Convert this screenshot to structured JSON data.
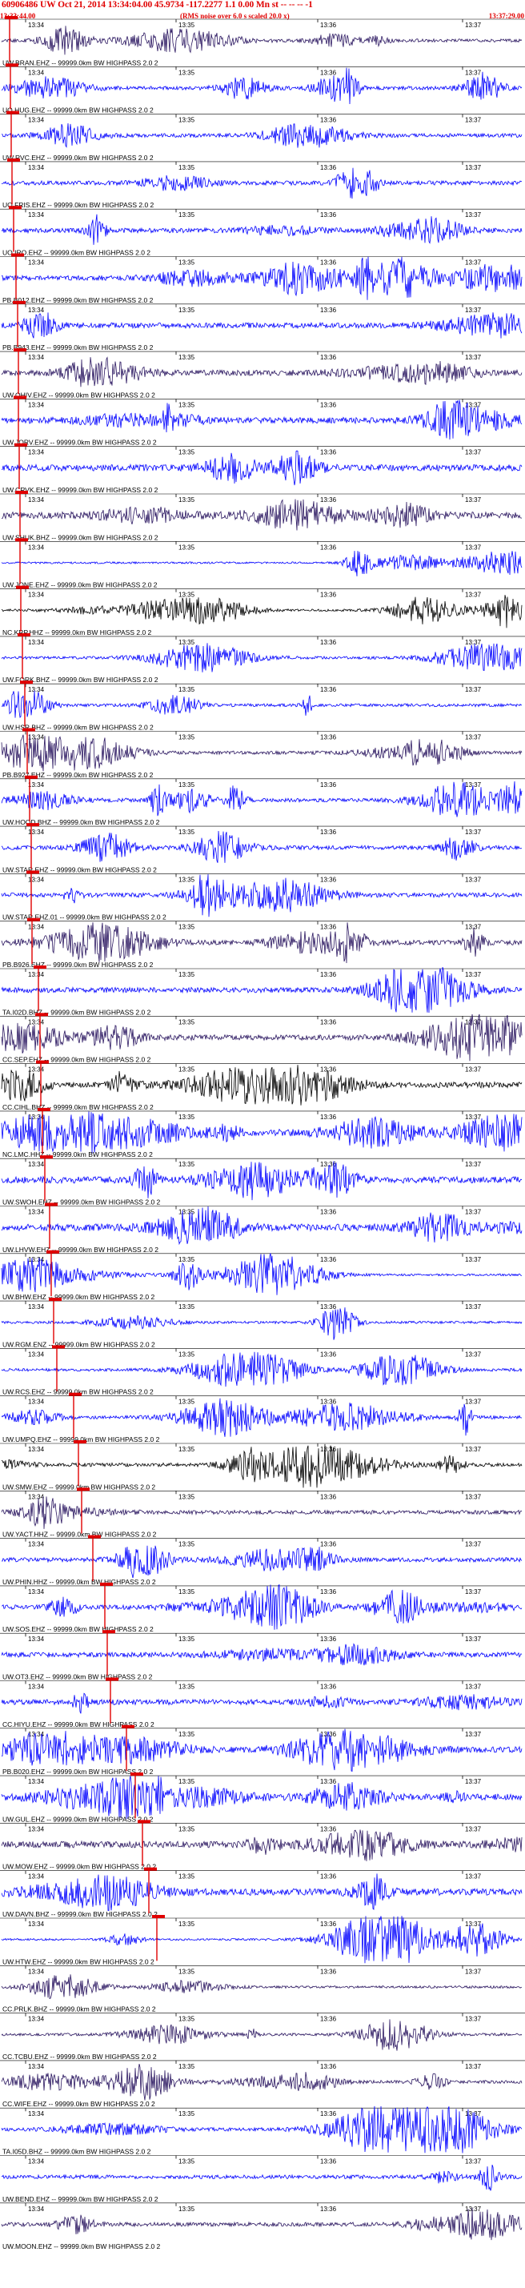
{
  "header": {
    "title": "60906486 UW Oct 21, 2014 13:34:04.00   45.9734 -117.2277  1.1 0.00 Mn st -- -- -- -1",
    "start_time": "13:33:44.00",
    "note": "(RMS noise over 6.0 s scaled 20.0 x)",
    "end_time": "13:37:29.00"
  },
  "colors": {
    "header_red": "#e00000",
    "trace_blue": "#0000ff",
    "trace_purple": "#2a1660",
    "trace_black": "#000000",
    "pick_red": "#e00000",
    "gridline": "#000000"
  },
  "chart_data": {
    "type": "line",
    "title": "60906486 UW Oct 21, 2014 13:34:04.00   45.9734 -117.2277  1.1 0.00 Mn st -- -- -- -1",
    "xlabel": "",
    "ylabel": "",
    "xlim": [
      "13:33:44.00",
      "13:37:29.00"
    ],
    "time_ticks": [
      "13:34",
      "13:35",
      "13:36",
      "13:37"
    ],
    "grid": true,
    "series": [
      {
        "name": "UW.BRAN.EHZ -- 99999.0km BW HIGHPASS 2.0 2",
        "color": "purple",
        "pick": 12
      },
      {
        "name": "UO.HUG.EHZ -- 99999.0km BW HIGHPASS 2.0 2",
        "color": "blue",
        "pick": 13
      },
      {
        "name": "UW.RVC.EHZ -- 99999.0km BW HIGHPASS 2.0 2",
        "color": "blue",
        "pick": 14
      },
      {
        "name": "UO.FRIS.EHZ -- 99999.0km BW HIGHPASS 2.0 2",
        "color": "blue",
        "pick": 15
      },
      {
        "name": "UO.IRO.EHZ -- 99999.0km BW HIGHPASS 2.0 2",
        "color": "blue",
        "pick": 17
      },
      {
        "name": "PB.B012.EHZ -- 99999.0km BW HIGHPASS 2.0 2",
        "color": "blue",
        "pick": 20
      },
      {
        "name": "PB.B943.EHZ -- 99999.0km BW HIGHPASS 2.0 2",
        "color": "blue",
        "pick": 22
      },
      {
        "name": "UW.OHIV.EHZ -- 99999.0km BW HIGHPASS 2.0 2",
        "color": "purple",
        "pick": 23
      },
      {
        "name": "UW.JORV.EHZ -- 99999.0km BW HIGHPASS 2.0 2",
        "color": "blue",
        "pick": 23
      },
      {
        "name": "UW.CRVK.EHZ -- 99999.0km BW HIGHPASS 2.0 2",
        "color": "blue",
        "pick": 24
      },
      {
        "name": "UW.SHUK.BHZ -- 99999.0km BW HIGHPASS 2.0 2",
        "color": "purple",
        "pick": 25
      },
      {
        "name": "UW.JONE.EHZ -- 99999.0km BW HIGHPASS 2.0 2",
        "color": "blue",
        "pick": 25
      },
      {
        "name": "NC.KRP.HHZ -- 99999.0km BW HIGHPASS 2.0 2",
        "color": "black",
        "pick": 26
      },
      {
        "name": "UW.FORK.BHZ -- 99999.0km BW HIGHPASS 2.0 2",
        "color": "blue",
        "pick": 28
      },
      {
        "name": "UW.HSR.BHZ -- 99999.0km BW HIGHPASS 2.0 2",
        "color": "blue",
        "pick": 31
      },
      {
        "name": "PB.B927.EHZ -- 99999.0km BW HIGHPASS 2.0 2",
        "color": "purple",
        "pick": 34
      },
      {
        "name": "UW.HOOD.BHZ -- 99999.0km BW HIGHPASS 2.0 2",
        "color": "blue",
        "pick": 37
      },
      {
        "name": "UW.STAR.EHZ -- 99999.0km BW HIGHPASS 2.0 2",
        "color": "blue",
        "pick": 39
      },
      {
        "name": "UW.STAR.EHZ.01 -- 99999.0km BW HIGHPASS 2.0 2",
        "color": "blue",
        "pick": 39
      },
      {
        "name": "PB.B926.EHZ -- 99999.0km BW HIGHPASS 2.0 2",
        "color": "purple",
        "pick": 40
      },
      {
        "name": "TA.I02D.BHZ -- 99999.0km BW HIGHPASS 2.0 2",
        "color": "blue",
        "pick": 48
      },
      {
        "name": "CC.SEP.EHZ -- 99999.0km BW HIGHPASS 2.0 2",
        "color": "purple",
        "pick": 50
      },
      {
        "name": "CC.CIHL.BHZ -- 99999.0km BW HIGHPASS 2.0 2",
        "color": "black",
        "pick": 51
      },
      {
        "name": "NC.LMC.HHZ -- 99999.0km BW HIGHPASS 2.0 2",
        "color": "blue",
        "pick": 53
      },
      {
        "name": "UW.SWOH.EHZ -- 99999.0km BW HIGHPASS 2.0 2",
        "color": "blue",
        "pick": 56
      },
      {
        "name": "UW.LHVW.EHZ -- 99999.0km BW HIGHPASS 2.0 2",
        "color": "blue",
        "pick": 62
      },
      {
        "name": "UW.BHW.EHZ -- 99999.0km BW HIGHPASS 2.0 2",
        "color": "blue",
        "pick": 64
      },
      {
        "name": "UW.RGM.ENZ -- 99999.0km BW HIGHPASS 2.0 2",
        "color": "blue",
        "pick": 67
      },
      {
        "name": "UW.RCS.EHZ -- 99999.0km BW HIGHPASS 2.0 2",
        "color": "blue",
        "pick": 71
      },
      {
        "name": "UW.UMPQ.EHZ -- 99999.0km BW HIGHPASS 2.0 2",
        "color": "blue",
        "pick": 92
      },
      {
        "name": "UW.SMW.EHZ -- 99999.0km BW HIGHPASS 2.0 2",
        "color": "black",
        "pick": 98
      },
      {
        "name": "UW.YACT.HHZ -- 99999.0km BW HIGHPASS 2.0 2",
        "color": "purple",
        "pick": 102
      },
      {
        "name": "UW.PHIN.HHZ -- 99999.0km BW HIGHPASS 2.0 2",
        "color": "blue",
        "pick": 116
      },
      {
        "name": "UW.SOS.EHZ -- 99999.0km BW HIGHPASS 2.0 2",
        "color": "blue",
        "pick": 131
      },
      {
        "name": "UW.OT3.EHZ -- 99999.0km BW HIGHPASS 2.0 2",
        "color": "blue",
        "pick": 134
      },
      {
        "name": "CC.HIYU.EHZ -- 99999.0km BW HIGHPASS 2.0 2",
        "color": "blue",
        "pick": 138
      },
      {
        "name": "PB.B020.EHZ -- 99999.0km BW HIGHPASS 2.0 2",
        "color": "blue",
        "pick": 158
      },
      {
        "name": "UW.GUL.EHZ -- 99999.0km BW HIGHPASS 2.0 2",
        "color": "blue",
        "pick": 169
      },
      {
        "name": "UW.MOW.EHZ -- 99999.0km BW HIGHPASS 2.0 2",
        "color": "purple",
        "pick": 178
      },
      {
        "name": "UW.DAVN.BHZ -- 99999.0km BW HIGHPASS 2.0 2",
        "color": "blue",
        "pick": 186
      },
      {
        "name": "UW.HTW.EHZ -- 99999.0km BW HIGHPASS 2.0 2",
        "color": "blue",
        "pick": 196
      },
      {
        "name": "CC.PRLK.BHZ -- 99999.0km BW HIGHPASS 2.0 2",
        "color": "purple",
        "pick": null
      },
      {
        "name": "CC.TCBU.EHZ -- 99999.0km BW HIGHPASS 2.0 2",
        "color": "purple",
        "pick": null
      },
      {
        "name": "CC.WIFE.EHZ -- 99999.0km BW HIGHPASS 2.0 2",
        "color": "purple",
        "pick": null
      },
      {
        "name": "TA.I05D.BHZ -- 99999.0km BW HIGHPASS 2.0 2",
        "color": "blue",
        "pick": null
      },
      {
        "name": "UW.BEND.EHZ -- 99999.0km BW HIGHPASS 2.0 2",
        "color": "blue",
        "pick": null
      },
      {
        "name": "UW.MOON.EHZ -- 99999.0km BW HIGHPASS 2.0 2",
        "color": "purple",
        "pick": null
      }
    ]
  }
}
